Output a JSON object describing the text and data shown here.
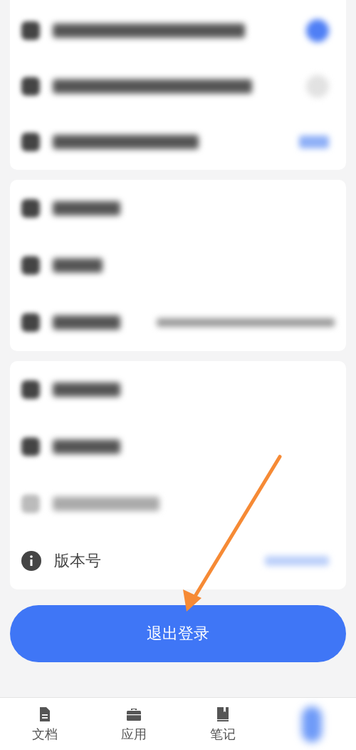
{
  "sections": [
    {
      "rows": [
        {
          "kind": "toggle",
          "on": true
        },
        {
          "kind": "toggle",
          "on": false
        },
        {
          "kind": "value"
        }
      ]
    },
    {
      "rows": [
        {
          "kind": "plain"
        },
        {
          "kind": "plain"
        },
        {
          "kind": "email"
        }
      ]
    },
    {
      "rows": [
        {
          "kind": "plain"
        },
        {
          "kind": "plain"
        },
        {
          "kind": "plain"
        },
        {
          "kind": "version",
          "label": "版本号"
        }
      ]
    }
  ],
  "logout_button": "退出登录",
  "tabs": [
    {
      "label": "文档",
      "selected": false
    },
    {
      "label": "应用",
      "selected": false
    },
    {
      "label": "笔记",
      "selected": false
    },
    {
      "selected": true
    }
  ]
}
